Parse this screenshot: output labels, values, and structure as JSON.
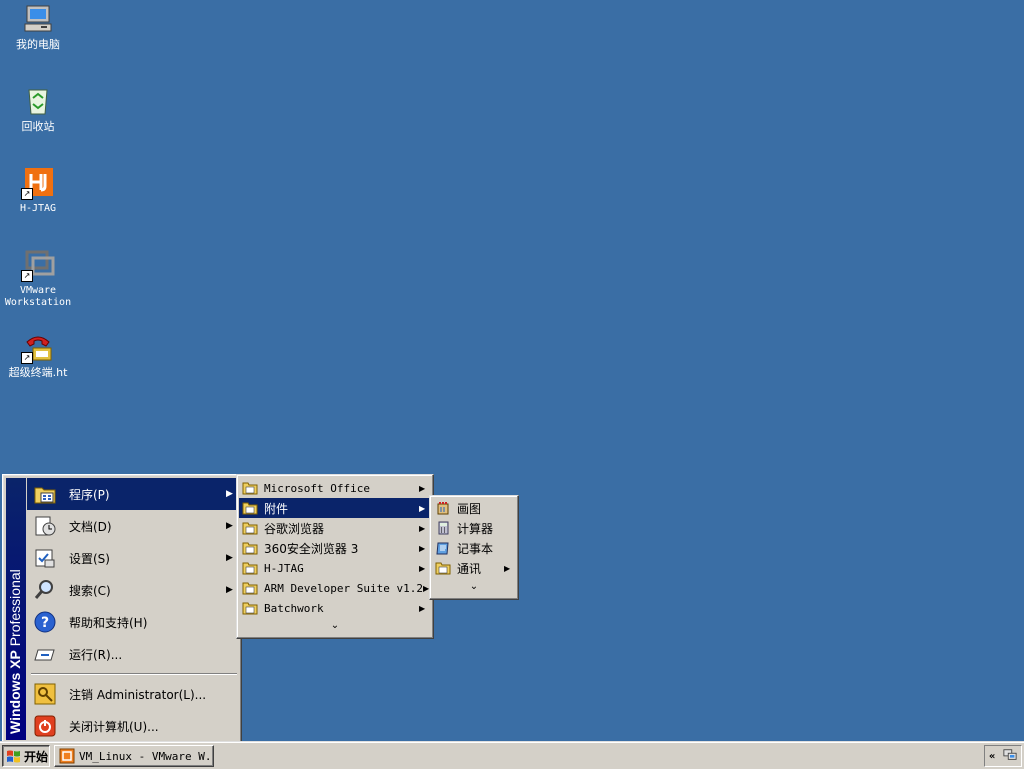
{
  "desktop": {
    "icons": [
      {
        "label": "我的电脑",
        "icon": "my-computer-icon"
      },
      {
        "label": "回收站",
        "icon": "recycle-bin-icon"
      },
      {
        "label": "H-JTAG",
        "icon": "hjtag-icon"
      },
      {
        "label_line1": "VMware",
        "label_line2": "Workstation",
        "icon": "vmware-icon"
      },
      {
        "label": "超级终端.ht",
        "icon": "hyperterminal-icon"
      }
    ]
  },
  "start_menu": {
    "banner_brand": "Windows XP",
    "banner_edition": "Professional",
    "items": [
      {
        "label": "程序(P)",
        "icon": "programs-icon",
        "submenu": true
      },
      {
        "label": "文档(D)",
        "icon": "documents-icon",
        "submenu": true
      },
      {
        "label": "设置(S)",
        "icon": "settings-icon",
        "submenu": true
      },
      {
        "label": "搜索(C)",
        "icon": "search-icon",
        "submenu": true
      },
      {
        "label": "帮助和支持(H)",
        "icon": "help-icon",
        "submenu": false
      },
      {
        "label": "运行(R)...",
        "icon": "run-icon",
        "submenu": false
      },
      {
        "label": "注销 Administrator(L)...",
        "icon": "logoff-icon",
        "submenu": false
      },
      {
        "label": "关闭计算机(U)...",
        "icon": "shutdown-icon",
        "submenu": false
      }
    ]
  },
  "programs_menu": {
    "items": [
      {
        "label": "Microsoft Office"
      },
      {
        "label": "附件"
      },
      {
        "label": "谷歌浏览器"
      },
      {
        "label": "360安全浏览器 3"
      },
      {
        "label": "H-JTAG"
      },
      {
        "label": "ARM Developer Suite v1.2"
      },
      {
        "label": "Batchwork"
      }
    ],
    "expand_glyph": "⌄"
  },
  "accessories_menu": {
    "items": [
      {
        "label": "画图",
        "icon": "paint-icon"
      },
      {
        "label": "计算器",
        "icon": "calculator-icon"
      },
      {
        "label": "记事本",
        "icon": "notepad-icon"
      },
      {
        "label": "通讯",
        "icon": "folder-icon"
      }
    ],
    "expand_glyph": "⌄"
  },
  "taskbar": {
    "start_label": "开始",
    "task_label": "VM_Linux - VMware W...",
    "tray_chevron": "«"
  },
  "colors": {
    "desktop": "#3a6ea5",
    "highlight": "#0a246a",
    "menu_face": "#d4d0c8"
  }
}
